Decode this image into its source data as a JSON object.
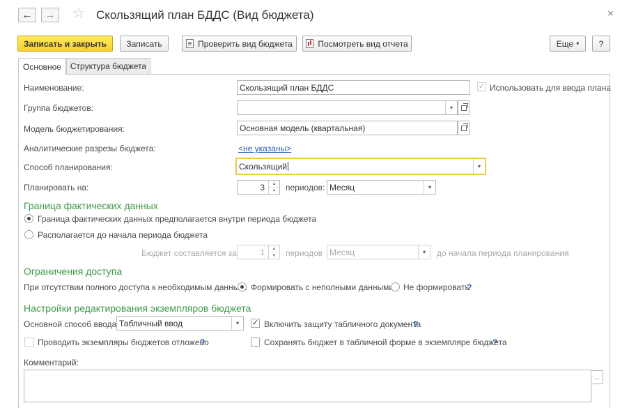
{
  "window": {
    "title": "Скользящий план БДДС (Вид бюджета)",
    "back_icon": "←",
    "forward_icon": "→",
    "star_icon": "☆",
    "close_icon": "×"
  },
  "toolbar": {
    "save_close": "Записать и закрыть",
    "save": "Записать",
    "check": "Проверить вид бюджета",
    "view_report": "Посмотреть вид отчета",
    "more": "Еще",
    "more_arrow": "▾",
    "help": "?"
  },
  "tabs": [
    {
      "label": "Основное",
      "active": true
    },
    {
      "label": "Структура бюджета",
      "active": false
    }
  ],
  "form": {
    "name": {
      "label": "Наименование:",
      "value": "Скользящий план БДДС"
    },
    "use_for_plan": {
      "label": "Использовать для ввода плана",
      "checked": true,
      "check": "✓"
    },
    "budget_group": {
      "label": "Группа бюджетов:",
      "value": ""
    },
    "budget_model": {
      "label": "Модель бюджетирования:",
      "value": "Основная модель (квартальная)"
    },
    "analytic_cuts": {
      "label": "Аналитические разрезы бюджета:",
      "link": "<не указаны>"
    },
    "planning_method": {
      "label": "Способ планирования:",
      "value": "Скользящий"
    },
    "plan_for": {
      "label": "Планировать на:",
      "value": "3",
      "periods_label": "периодов:",
      "period": "Месяц"
    },
    "dd_arrow": "▾",
    "spin_up": "▲",
    "spin_down": "▼",
    "open_icon": "⧉"
  },
  "fact_border": {
    "title": "Граница фактических данных",
    "option1": "Граница фактических данных предполагается внутри периода бюджета",
    "option2": "Располагается до начала периода бюджета",
    "selected": "option1",
    "compiled_for_label": "Бюджет составляется за:",
    "compiled_for_value": "1",
    "periods_label": "периодов",
    "period": "Месяц",
    "before_start": "до начала периода планирования"
  },
  "access": {
    "title": "Ограничения доступа",
    "label": "При отсутствии полного доступа к необходимым данным:",
    "option1": "Формировать с неполными данными",
    "option2": "Не формировать",
    "help": "?"
  },
  "editing": {
    "title": "Настройки редактирования экземпляров бюджета",
    "input_method_label": "Основной способ ввода:",
    "input_method": "Табличный ввод",
    "protect_label": "Включить защиту табличного документа",
    "protect_checked": true,
    "protect_check": "✓",
    "protect_help": "?",
    "deferred_label": "Проводить экземпляры бюджетов отложено",
    "deferred_checked": false,
    "deferred_help": "?",
    "save_table_label": "Сохранять бюджет в табличной форме в экземпляре бюджета",
    "save_table_checked": false,
    "save_table_help": "?"
  },
  "comment": {
    "label": "Комментарий:",
    "value": "",
    "more_button": "..."
  }
}
